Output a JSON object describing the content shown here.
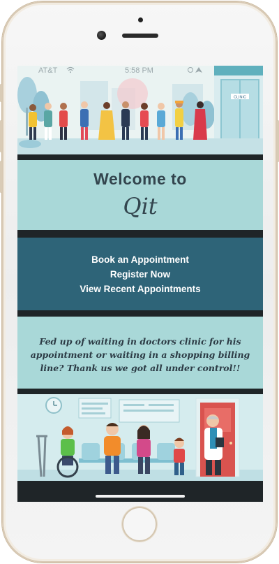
{
  "status_bar": {
    "carrier": "AT&T",
    "time": "5:58 PM"
  },
  "welcome": {
    "line1": "Welcome to",
    "line2": "Qit"
  },
  "menu": {
    "items": [
      {
        "label": "Book an Appointment"
      },
      {
        "label": "Register Now"
      },
      {
        "label": "View Recent Appointments"
      }
    ]
  },
  "tagline": "Fed up of waiting in doctors clinic for his appointment or waiting in a shopping billing line? Thank us we got all under control!!",
  "hero_sign": "CLINIC",
  "colors": {
    "welcome_bg": "#a9d8d8",
    "menu_bg": "#2e6478",
    "divider": "#1f2528",
    "text_dark": "#33454e"
  },
  "icons": [
    "phone-frame",
    "camera-icon",
    "speaker-icon",
    "home-button-icon",
    "clock-icon",
    "crutches-icon"
  ]
}
